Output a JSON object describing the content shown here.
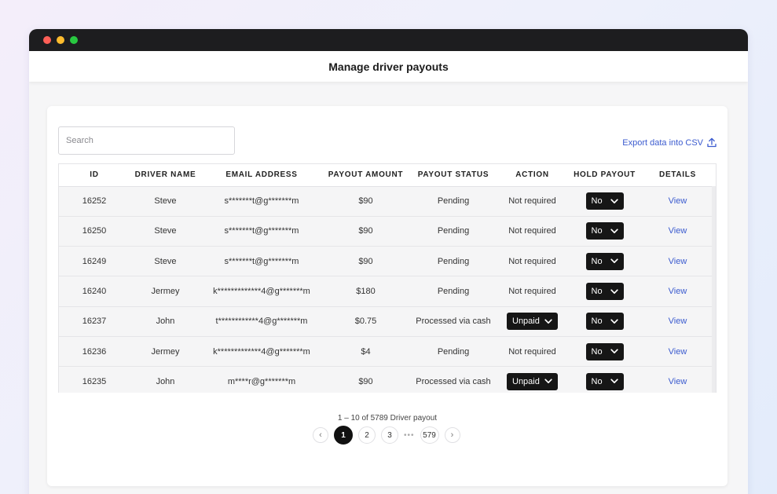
{
  "page": {
    "title": "Manage driver payouts"
  },
  "window": {
    "dots": [
      "#ff5f57",
      "#febc2e",
      "#28c840"
    ]
  },
  "search": {
    "placeholder": "Search",
    "value": ""
  },
  "export": {
    "label": "Export data into CSV",
    "icon": "upload-icon"
  },
  "table": {
    "columns": [
      "ID",
      "DRIVER NAME",
      "EMAIL ADDRESS",
      "PAYOUT AMOUNT",
      "PAYOUT STATUS",
      "ACTION",
      "HOLD PAYOUT",
      "DETAILS"
    ],
    "rows": [
      {
        "id": "16252",
        "name": "Steve",
        "email": "s*******t@g*******m",
        "amount": "$90",
        "status": "Pending",
        "action": "Not required",
        "hold": "No",
        "details": "View"
      },
      {
        "id": "16250",
        "name": "Steve",
        "email": "s*******t@g*******m",
        "amount": "$90",
        "status": "Pending",
        "action": "Not required",
        "hold": "No",
        "details": "View"
      },
      {
        "id": "16249",
        "name": "Steve",
        "email": "s*******t@g*******m",
        "amount": "$90",
        "status": "Pending",
        "action": "Not required",
        "hold": "No",
        "details": "View"
      },
      {
        "id": "16240",
        "name": "Jermey",
        "email": "k*************4@g*******m",
        "amount": "$180",
        "status": "Pending",
        "action": "Not required",
        "hold": "No",
        "details": "View"
      },
      {
        "id": "16237",
        "name": "John",
        "email": "t************4@g*******m",
        "amount": "$0.75",
        "status": "Processed via cash",
        "action": "Unpaid",
        "hold": "No",
        "details": "View"
      },
      {
        "id": "16236",
        "name": "Jermey",
        "email": "k*************4@g*******m",
        "amount": "$4",
        "status": "Pending",
        "action": "Not required",
        "hold": "No",
        "details": "View"
      },
      {
        "id": "16235",
        "name": "John",
        "email": "m****r@g*******m",
        "amount": "$90",
        "status": "Processed via cash",
        "action": "Unpaid",
        "hold": "No",
        "details": "View"
      }
    ]
  },
  "pagination": {
    "summary": "1 – 10 of 5789 Driver payout",
    "prev": "‹",
    "next": "›",
    "pages": [
      "1",
      "2",
      "3"
    ],
    "ellipsis": "•••",
    "last": "579",
    "current": "1"
  }
}
